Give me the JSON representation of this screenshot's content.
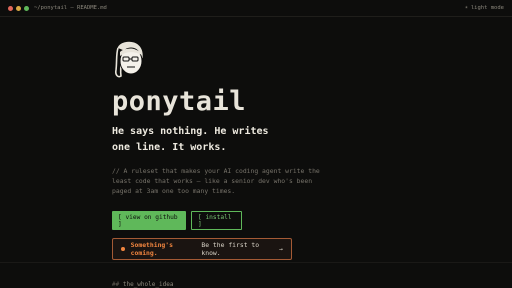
{
  "topbar": {
    "path": "~/ponytail — README.md",
    "light_mode_label": "light mode",
    "light_mode_icon": "sun-icon"
  },
  "hero": {
    "avatar_icon": "ponytail-avatar-icon",
    "title": "ponytail",
    "tagline": "He says nothing. He writes one line. It works.",
    "description": "// A ruleset that makes your AI coding agent write the least code that works — like a senior dev who's been paged at 3am one too many times."
  },
  "actions": {
    "github_label": "[ view on github ]",
    "install_label": "[ install ]"
  },
  "notice": {
    "highlight": "Something's coming.",
    "text": "Be the first to know.",
    "arrow": "→"
  },
  "section": {
    "hash": "##",
    "title": "the_whole_idea"
  },
  "colors": {
    "background": "#0d0d0c",
    "accent_green": "#5fb85a",
    "accent_orange": "#f0853f"
  }
}
